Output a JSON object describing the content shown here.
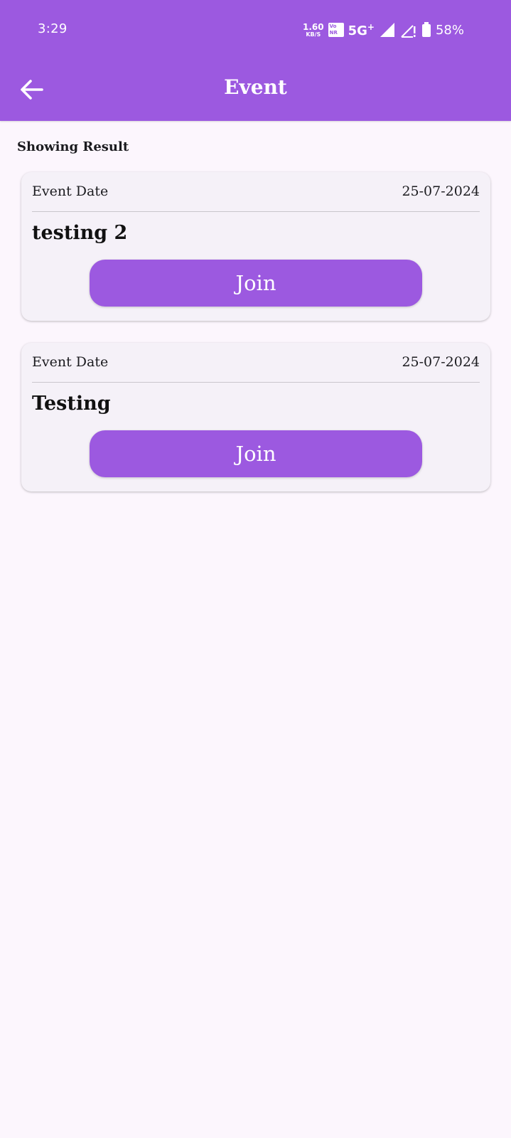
{
  "status_bar": {
    "time": "3:29",
    "net_speed_value": "1.60",
    "net_speed_unit": "KB/S",
    "volte_top": "Vo",
    "volte_bottom": "NR",
    "network_type": "5G",
    "network_plus": "+",
    "battery_percent": "58%"
  },
  "app_bar": {
    "title": "Event",
    "back_icon": "arrow-left-icon"
  },
  "results_label": "Showing Result",
  "events": [
    {
      "date_label": "Event Date",
      "date": "25-07-2024",
      "name": "testing 2",
      "button_label": "Join"
    },
    {
      "date_label": "Event Date",
      "date": "25-07-2024",
      "name": "Testing",
      "button_label": "Join"
    }
  ],
  "colors": {
    "primary": "#9c59e0",
    "background": "#fcf6fd",
    "card": "#f5f1f8"
  }
}
